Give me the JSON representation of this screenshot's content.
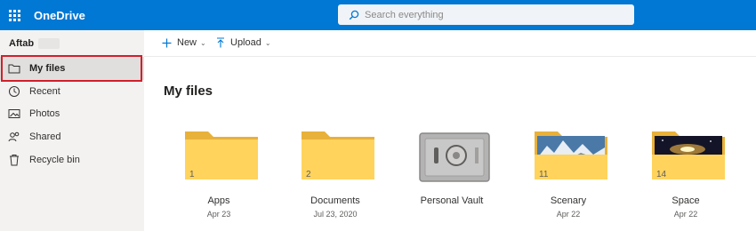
{
  "app": {
    "name": "OneDrive"
  },
  "search": {
    "placeholder": "Search everything"
  },
  "sidebar": {
    "user_name": "Aftab",
    "items": [
      {
        "label": "My files",
        "icon": "folder-icon",
        "active": true
      },
      {
        "label": "Recent",
        "icon": "recent-icon"
      },
      {
        "label": "Photos",
        "icon": "photos-icon"
      },
      {
        "label": "Shared",
        "icon": "shared-icon"
      },
      {
        "label": "Recycle bin",
        "icon": "recycle-bin-icon"
      }
    ]
  },
  "commands": {
    "new_label": "New",
    "upload_label": "Upload"
  },
  "main": {
    "title": "My files",
    "items": [
      {
        "name": "Apps",
        "date": "Apr 23",
        "count": "1",
        "kind": "folder"
      },
      {
        "name": "Documents",
        "date": "Jul 23, 2020",
        "count": "2",
        "kind": "folder"
      },
      {
        "name": "Personal Vault",
        "date": "",
        "count": "",
        "kind": "vault"
      },
      {
        "name": "Scenary",
        "date": "Apr 22",
        "count": "11",
        "kind": "photo-folder"
      },
      {
        "name": "Space",
        "date": "Apr 22",
        "count": "14",
        "kind": "photo-folder"
      }
    ]
  },
  "colors": {
    "brand": "#0078d4",
    "folder": "#ffd05b",
    "highlight": "#d0202c"
  }
}
